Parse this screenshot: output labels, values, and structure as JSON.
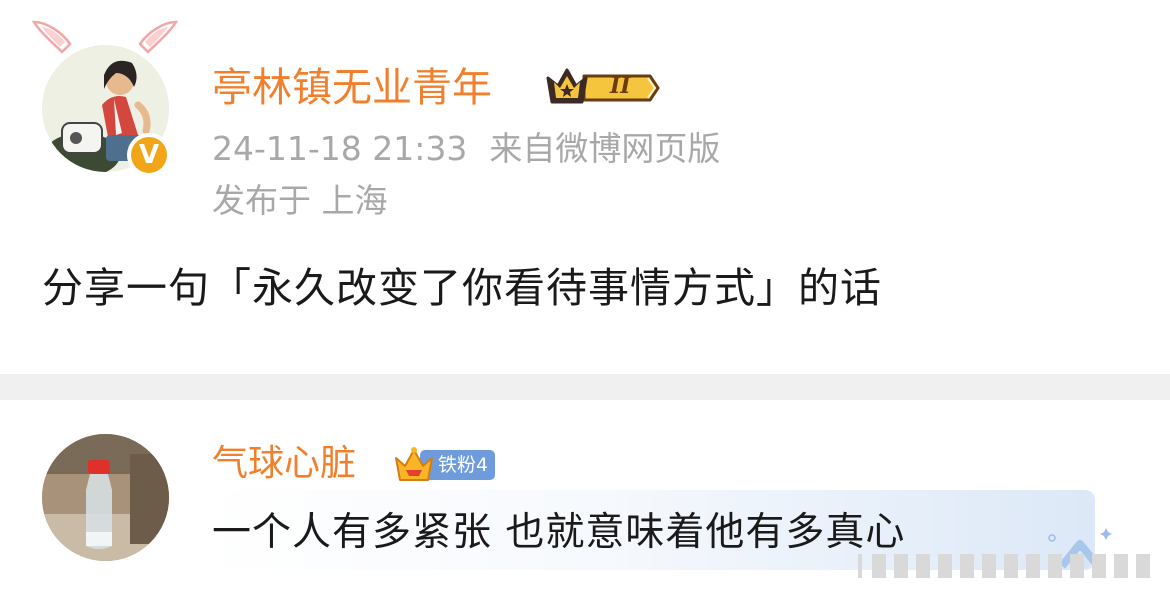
{
  "post": {
    "author": "亭林镇无业青年",
    "vip_level": "II",
    "timestamp": "24-11-18 21:33",
    "source": "来自微博网页版",
    "location": "发布于 上海",
    "text": "分享一句「永久改变了你看待事情方式」的话"
  },
  "comment": {
    "author": "气球心脏",
    "fan_badge": "铁粉4",
    "text": "一个人有多紧张 也就意味着他有多真心"
  },
  "colors": {
    "username": "#f0802d",
    "meta_gray": "#a8a8a8",
    "verified_badge": "#f2a516",
    "fan_badge": "#6d9bdc",
    "divider": "#f0f0f0"
  },
  "icons": {
    "ears": "bunny-ears-icon",
    "verified": "verified-v-icon",
    "vip": "crown-vip-icon",
    "fan": "crown-fan-icon",
    "bubble": "bubble-decoration-icon"
  }
}
